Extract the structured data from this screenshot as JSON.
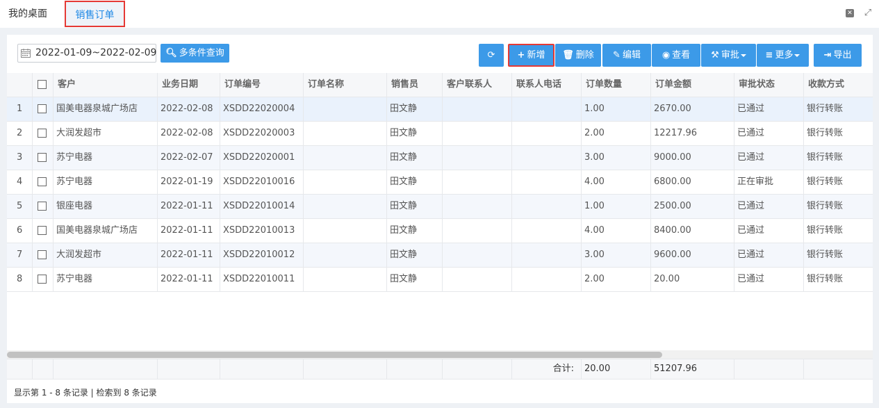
{
  "tabs": {
    "home": "我的桌面",
    "active": "销售订单"
  },
  "toolbar": {
    "date_range": "2022-01-09~2022-02-09",
    "search_label": "多条件查询",
    "add_label": "新增",
    "delete_label": "删除",
    "edit_label": "编辑",
    "view_label": "查看",
    "approve_label": "审批",
    "more_label": "更多",
    "export_label": "导出"
  },
  "table": {
    "headers": [
      "客户",
      "业务日期",
      "订单编号",
      "订单名称",
      "销售员",
      "客户联系人",
      "联系人电话",
      "订单数量",
      "订单金额",
      "审批状态",
      "收款方式"
    ],
    "rows": [
      {
        "num": "1",
        "customer": "国美电器泉城广场店",
        "date": "2022-02-08",
        "code": "XSDD22020004",
        "name": "",
        "seller": "田文静",
        "contact": "",
        "phone": "",
        "qty": "1.00",
        "amount": "2670.00",
        "status": "已通过",
        "payment": "银行转账"
      },
      {
        "num": "2",
        "customer": "大润发超市",
        "date": "2022-02-08",
        "code": "XSDD22020003",
        "name": "",
        "seller": "田文静",
        "contact": "",
        "phone": "",
        "qty": "2.00",
        "amount": "12217.96",
        "status": "已通过",
        "payment": "银行转账"
      },
      {
        "num": "3",
        "customer": "苏宁电器",
        "date": "2022-02-07",
        "code": "XSDD22020001",
        "name": "",
        "seller": "田文静",
        "contact": "",
        "phone": "",
        "qty": "3.00",
        "amount": "9000.00",
        "status": "已通过",
        "payment": "银行转账"
      },
      {
        "num": "4",
        "customer": "苏宁电器",
        "date": "2022-01-19",
        "code": "XSDD22010016",
        "name": "",
        "seller": "田文静",
        "contact": "",
        "phone": "",
        "qty": "4.00",
        "amount": "6800.00",
        "status": "正在审批",
        "payment": "银行转账"
      },
      {
        "num": "5",
        "customer": "银座电器",
        "date": "2022-01-11",
        "code": "XSDD22010014",
        "name": "",
        "seller": "田文静",
        "contact": "",
        "phone": "",
        "qty": "1.00",
        "amount": "2500.00",
        "status": "已通过",
        "payment": "银行转账"
      },
      {
        "num": "6",
        "customer": "国美电器泉城广场店",
        "date": "2022-01-11",
        "code": "XSDD22010013",
        "name": "",
        "seller": "田文静",
        "contact": "",
        "phone": "",
        "qty": "4.00",
        "amount": "8400.00",
        "status": "已通过",
        "payment": "银行转账"
      },
      {
        "num": "7",
        "customer": "大润发超市",
        "date": "2022-01-11",
        "code": "XSDD22010012",
        "name": "",
        "seller": "田文静",
        "contact": "",
        "phone": "",
        "qty": "3.00",
        "amount": "9600.00",
        "status": "已通过",
        "payment": "银行转账"
      },
      {
        "num": "8",
        "customer": "苏宁电器",
        "date": "2022-01-11",
        "code": "XSDD22010011",
        "name": "",
        "seller": "田文静",
        "contact": "",
        "phone": "",
        "qty": "2.00",
        "amount": "20.00",
        "status": "已通过",
        "payment": "银行转账"
      }
    ]
  },
  "footer": {
    "total_label": "合计:",
    "total_qty": "20.00",
    "total_amount": "51207.96",
    "pager_text": "显示第 1 - 8 条记录 | 检索到 8 条记录"
  },
  "colors": {
    "accent": "#3c9ae8",
    "highlight": "#e53935",
    "active_tab": "#1e88e5"
  }
}
